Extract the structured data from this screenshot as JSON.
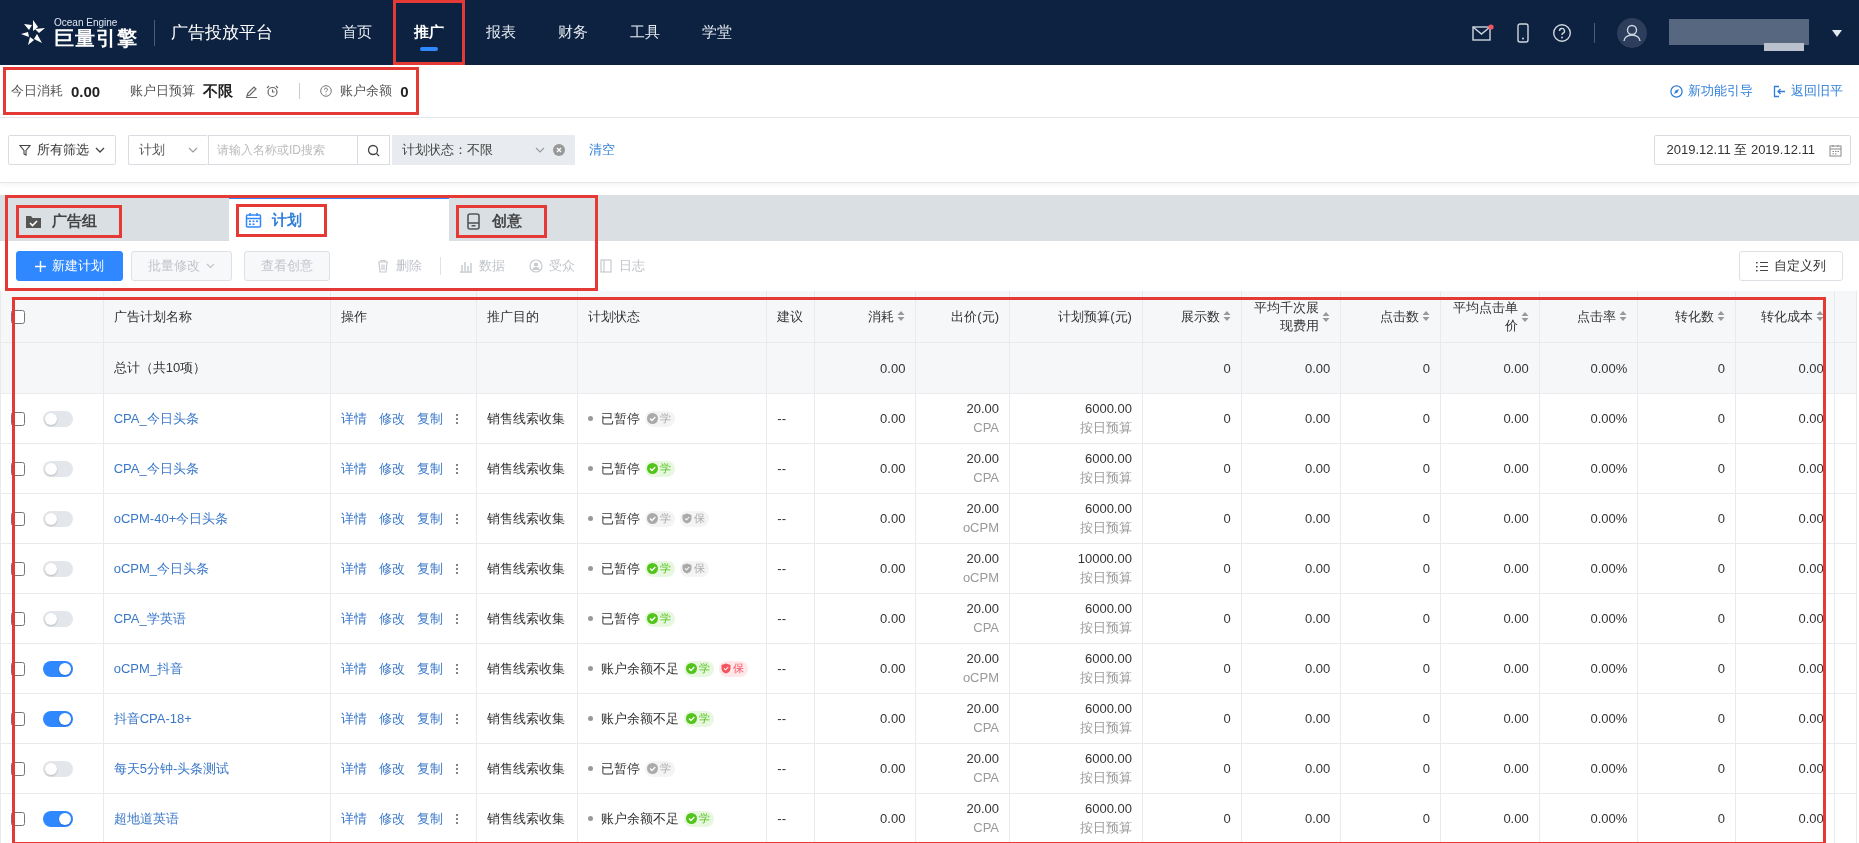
{
  "header": {
    "logo": {
      "brand_en": "Ocean Engine",
      "brand_cn": "巨量引擎"
    },
    "platform_title": "广告投放平台",
    "nav": [
      {
        "label": "首页",
        "selected": false,
        "highlighted": false
      },
      {
        "label": "推广",
        "selected": true,
        "highlighted": true
      },
      {
        "label": "报表",
        "selected": false,
        "highlighted": false
      },
      {
        "label": "财务",
        "selected": false,
        "highlighted": false
      },
      {
        "label": "工具",
        "selected": false,
        "highlighted": false
      },
      {
        "label": "学堂",
        "selected": false,
        "highlighted": false
      }
    ],
    "mail_unread": true
  },
  "summary": {
    "highlighted": true,
    "today_cost_label": "今日消耗",
    "today_cost": "0.00",
    "daily_budget_label": "账户日预算",
    "daily_budget": "不限",
    "balance_label": "账户余额",
    "balance": "0",
    "links": [
      {
        "label": "新功能引导",
        "kind": "guide"
      },
      {
        "label": "返回旧平",
        "kind": "back"
      }
    ]
  },
  "filters": {
    "all_filters": "所有筛选",
    "level_select": "计划",
    "search": {
      "placeholder": "请输入名称或ID搜索"
    },
    "status_filter": "计划状态：不限",
    "clear": "清空",
    "date_range": "2019.12.11 至 2019.12.11"
  },
  "tabs_panel": {
    "highlighted": true,
    "tabs": [
      {
        "label": "广告组",
        "kind": "group",
        "selected": false,
        "highlighted": true
      },
      {
        "label": "计划",
        "kind": "plan",
        "selected": true,
        "highlighted": true
      },
      {
        "label": "创意",
        "kind": "creative",
        "selected": false,
        "highlighted": true
      }
    ],
    "toolbar": [
      {
        "label": "新建计划",
        "kind": "primary",
        "disabled": false
      },
      {
        "label": "批量修改",
        "kind": "dropdown",
        "disabled": true
      },
      {
        "label": "查看创意",
        "kind": "outline",
        "disabled": true
      },
      {
        "label": "删除",
        "kind": "delete",
        "disabled": true
      },
      {
        "label": "数据",
        "kind": "data",
        "disabled": true
      },
      {
        "label": "受众",
        "kind": "audience",
        "disabled": true
      },
      {
        "label": "日志",
        "kind": "log",
        "disabled": true
      }
    ],
    "customize_columns": "自定义列"
  },
  "table": {
    "highlighted": true,
    "select_all_checked": false,
    "columns": [
      {
        "label": "广告计划名称",
        "sortable": false
      },
      {
        "label": "操作",
        "sortable": false
      },
      {
        "label": "推广目的",
        "sortable": false
      },
      {
        "label": "计划状态",
        "sortable": false
      },
      {
        "label": "建议",
        "sortable": false
      },
      {
        "label": "消耗",
        "sortable": true
      },
      {
        "label": "出价(元)",
        "sortable": false
      },
      {
        "label": "计划预算(元)",
        "sortable": false
      },
      {
        "label": "展示数",
        "sortable": true
      },
      {
        "label": "平均千次展现费用",
        "sortable": true
      },
      {
        "label": "点击数",
        "sortable": true
      },
      {
        "label": "平均点击单价",
        "sortable": true
      },
      {
        "label": "点击率",
        "sortable": true
      },
      {
        "label": "转化数",
        "sortable": true
      },
      {
        "label": "转化成本",
        "sortable": true
      }
    ],
    "total": {
      "label": "总计（共10项）",
      "cost": "0.00",
      "metrics": [
        "0",
        "0.00",
        "0",
        "0.00",
        "0.00%",
        "0",
        "0.00"
      ]
    },
    "rows": [
      {
        "checked": false,
        "on": false,
        "name": "CPA_今日头条",
        "actions": [
          "详情",
          "修改",
          "复制"
        ],
        "purpose": "销售线索收集",
        "status": "已暂停",
        "tags": [
          {
            "label": "学",
            "kind": "learn",
            "color": "#aaaaaa"
          }
        ],
        "suggestion": "--",
        "cost": "0.00",
        "bid": "20.00",
        "bid_type": "CPA",
        "budget": "6000.00",
        "budget_type": "按日预算",
        "metrics": [
          "0",
          "0.00",
          "0",
          "0.00",
          "0.00%",
          "0",
          "0.00"
        ]
      },
      {
        "checked": false,
        "on": false,
        "name": "CPA_今日头条",
        "actions": [
          "详情",
          "修改",
          "复制"
        ],
        "purpose": "销售线索收集",
        "status": "已暂停",
        "tags": [
          {
            "label": "学",
            "kind": "learn",
            "color": "#52c41a"
          }
        ],
        "suggestion": "--",
        "cost": "0.00",
        "bid": "20.00",
        "bid_type": "CPA",
        "budget": "6000.00",
        "budget_type": "按日预算",
        "metrics": [
          "0",
          "0.00",
          "0",
          "0.00",
          "0.00%",
          "0",
          "0.00"
        ]
      },
      {
        "checked": false,
        "on": false,
        "name": "oCPM-40+今日头条",
        "actions": [
          "详情",
          "修改",
          "复制"
        ],
        "purpose": "销售线索收集",
        "status": "已暂停",
        "tags": [
          {
            "label": "学",
            "kind": "learn",
            "color": "#aaaaaa"
          },
          {
            "label": "保",
            "kind": "guard",
            "color": "#aaaaaa"
          }
        ],
        "suggestion": "--",
        "cost": "0.00",
        "bid": "20.00",
        "bid_type": "oCPM",
        "budget": "6000.00",
        "budget_type": "按日预算",
        "metrics": [
          "0",
          "0.00",
          "0",
          "0.00",
          "0.00%",
          "0",
          "0.00"
        ]
      },
      {
        "checked": false,
        "on": false,
        "name": "oCPM_今日头条",
        "actions": [
          "详情",
          "修改",
          "复制"
        ],
        "purpose": "销售线索收集",
        "status": "已暂停",
        "tags": [
          {
            "label": "学",
            "kind": "learn",
            "color": "#52c41a"
          },
          {
            "label": "保",
            "kind": "guard",
            "color": "#aaaaaa"
          }
        ],
        "suggestion": "--",
        "cost": "0.00",
        "bid": "20.00",
        "bid_type": "oCPM",
        "budget": "10000.00",
        "budget_type": "按日预算",
        "metrics": [
          "0",
          "0.00",
          "0",
          "0.00",
          "0.00%",
          "0",
          "0.00"
        ]
      },
      {
        "checked": false,
        "on": false,
        "name": "CPA_学英语",
        "actions": [
          "详情",
          "修改",
          "复制"
        ],
        "purpose": "销售线索收集",
        "status": "已暂停",
        "tags": [
          {
            "label": "学",
            "kind": "learn",
            "color": "#52c41a"
          }
        ],
        "suggestion": "--",
        "cost": "0.00",
        "bid": "20.00",
        "bid_type": "CPA",
        "budget": "6000.00",
        "budget_type": "按日预算",
        "metrics": [
          "0",
          "0.00",
          "0",
          "0.00",
          "0.00%",
          "0",
          "0.00"
        ]
      },
      {
        "checked": false,
        "on": true,
        "name": "oCPM_抖音",
        "actions": [
          "详情",
          "修改",
          "复制"
        ],
        "purpose": "销售线索收集",
        "status": "账户余额不足",
        "tags": [
          {
            "label": "学",
            "kind": "learn",
            "color": "#52c41a"
          },
          {
            "label": "保",
            "kind": "guard",
            "color": "#f5535d"
          }
        ],
        "suggestion": "--",
        "cost": "0.00",
        "bid": "20.00",
        "bid_type": "oCPM",
        "budget": "6000.00",
        "budget_type": "按日预算",
        "metrics": [
          "0",
          "0.00",
          "0",
          "0.00",
          "0.00%",
          "0",
          "0.00"
        ]
      },
      {
        "checked": false,
        "on": true,
        "name": "抖音CPA-18+",
        "actions": [
          "详情",
          "修改",
          "复制"
        ],
        "purpose": "销售线索收集",
        "status": "账户余额不足",
        "tags": [
          {
            "label": "学",
            "kind": "learn",
            "color": "#52c41a"
          }
        ],
        "suggestion": "--",
        "cost": "0.00",
        "bid": "20.00",
        "bid_type": "CPA",
        "budget": "6000.00",
        "budget_type": "按日预算",
        "metrics": [
          "0",
          "0.00",
          "0",
          "0.00",
          "0.00%",
          "0",
          "0.00"
        ]
      },
      {
        "checked": false,
        "on": false,
        "name": "每天5分钟-头条测试",
        "actions": [
          "详情",
          "修改",
          "复制"
        ],
        "purpose": "销售线索收集",
        "status": "已暂停",
        "tags": [
          {
            "label": "学",
            "kind": "learn",
            "color": "#aaaaaa"
          }
        ],
        "suggestion": "--",
        "cost": "0.00",
        "bid": "20.00",
        "bid_type": "CPA",
        "budget": "6000.00",
        "budget_type": "按日预算",
        "metrics": [
          "0",
          "0.00",
          "0",
          "0.00",
          "0.00%",
          "0",
          "0.00"
        ]
      },
      {
        "checked": false,
        "on": true,
        "name": "超地道英语",
        "actions": [
          "详情",
          "修改",
          "复制"
        ],
        "purpose": "销售线索收集",
        "status": "账户余额不足",
        "tags": [
          {
            "label": "学",
            "kind": "learn",
            "color": "#52c41a"
          }
        ],
        "suggestion": "--",
        "cost": "0.00",
        "bid": "20.00",
        "bid_type": "CPA",
        "budget": "6000.00",
        "budget_type": "按日预算",
        "metrics": [
          "0",
          "0.00",
          "0",
          "0.00",
          "0.00%",
          "0",
          "0.00"
        ]
      }
    ]
  }
}
